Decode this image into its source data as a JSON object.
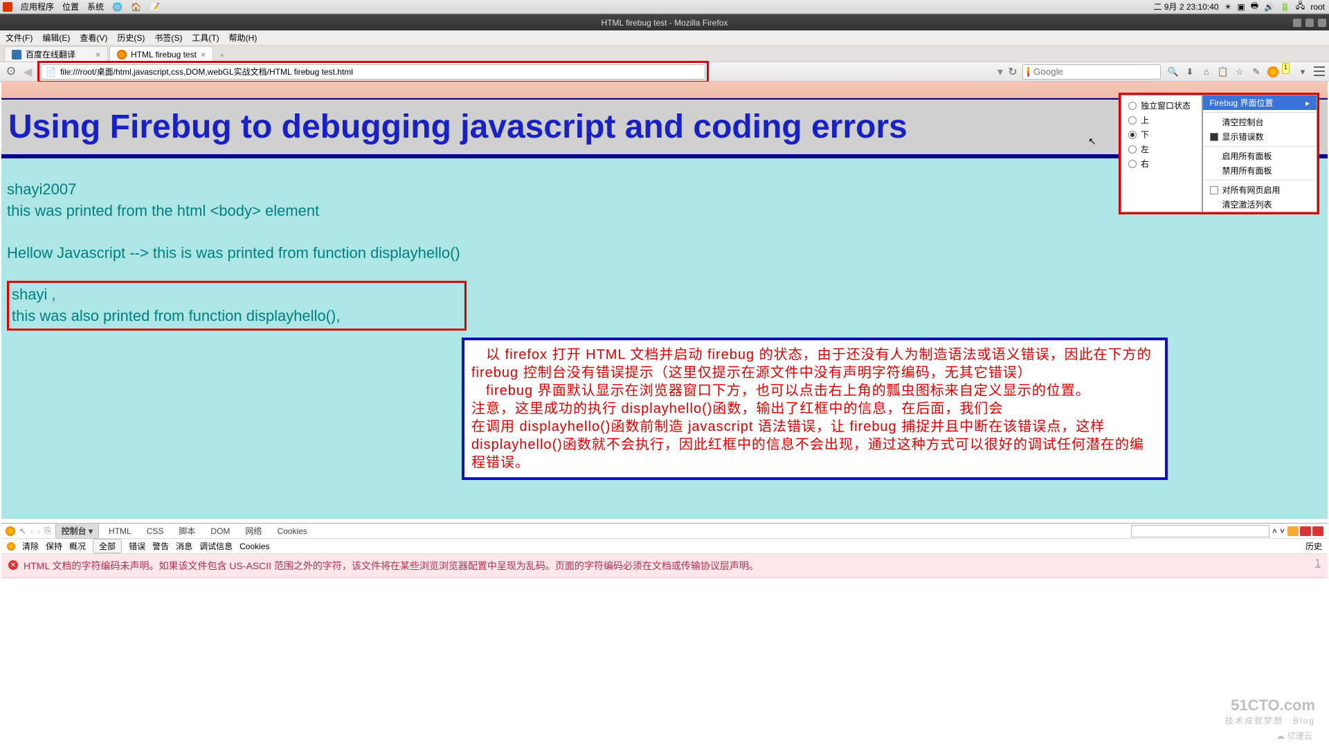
{
  "taskbar": {
    "apps": "应用程序",
    "places": "位置",
    "system": "系统",
    "datetime": "二 9月  2 23:10:40",
    "user": "root"
  },
  "window": {
    "title": "HTML firebug test - Mozilla Firefox"
  },
  "menu": {
    "file": "文件(F)",
    "edit": "编辑(E)",
    "view": "查看(V)",
    "history": "历史(S)",
    "bookmarks": "书签(S)",
    "tools": "工具(T)",
    "help": "帮助(H)"
  },
  "tabs": [
    {
      "label": "百度在线翻译"
    },
    {
      "label": "HTML firebug test"
    }
  ],
  "url": "file:///root/桌面/html,javascript,css,DOM,webGL实战文档/HTML firebug test.html",
  "search_placeholder": "Google",
  "firebug_badge": "1",
  "fb_menu_left": {
    "standalone": "独立窗口状态",
    "up": "上",
    "down": "下",
    "left": "左",
    "right": "右"
  },
  "fb_menu_right": {
    "position": "Firebug 界面位置",
    "clear_console": "清空控制台",
    "show_errors": "显示错误数",
    "enable_all": "启用所有面板",
    "disable_all": "禁用所有面板",
    "enable_for_all": "对所有网页启用",
    "clear_active": "清空激活列表"
  },
  "page": {
    "h1": "Using Firebug to debugging javascript and coding errors",
    "l1": "shayi2007",
    "l2": "this was printed from the html <body> element",
    "l3": "Hellow Javascript --> this is was printed from function displayhello()",
    "l4": "shayi ,",
    "l5": "this was also printed from function displayhello(),"
  },
  "annotation": {
    "p1": "　以 firefox 打开 HTML 文档并启动 firebug 的状态，由于还没有人为制造语法或语义错误，因此在下方的 firebug 控制台没有错误提示（这里仅提示在源文件中没有声明字符编码，无其它错误）",
    "p2": "　firebug 界面默认显示在浏览器窗口下方，也可以点击右上角的瓢虫图标来自定义显示的位置。",
    "p3": "注意，这里成功的执行 displayhello()函数，输出了红框中的信息，在后面，我们会",
    "p4": "在调用 displayhello()函数前制造 javascript 语法错误，让 firebug 捕捉并且中断在该错误点，这样 displayhello()函数就不会执行，因此红框中的信息不会出现，通过这种方式可以很好的调试任何潜在的编程错误。"
  },
  "fb": {
    "tabs": {
      "console": "控制台",
      "html": "HTML",
      "css": "CSS",
      "script": "脚本",
      "dom": "DOM",
      "net": "网络",
      "cookies": "Cookies"
    },
    "sub": {
      "clear": "清除",
      "keep": "保持",
      "summary": "概况",
      "all": "全部",
      "error": "错误",
      "warn": "警告",
      "info": "消息",
      "debug": "调试信息",
      "cookies": "Cookies"
    },
    "history": "历史",
    "error_text": "HTML 文档的字符编码未声明。如果该文件包含 US-ASCII 范围之外的字符，该文件将在某些浏览浏览器配置中呈现为乱码。页面的字符编码必须在文档或传输协议层声明。",
    "error_ln": "1"
  },
  "watermark": {
    "brand": "51CTO.com",
    "sub1": "技术成就梦想",
    "sub2": "Blog",
    "yisu": "亿速云"
  }
}
